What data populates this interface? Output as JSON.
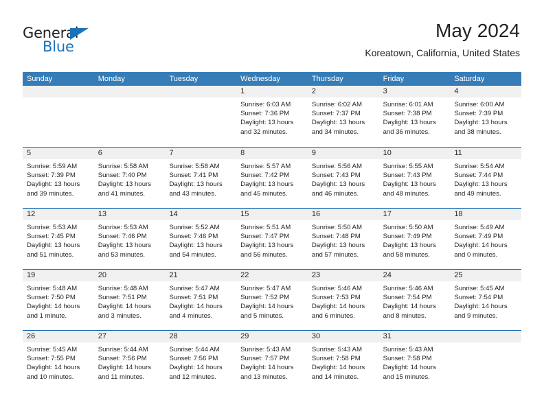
{
  "brand": {
    "name_part1": "General",
    "name_part2": "Blue",
    "accent_color": "#1b72b8"
  },
  "header": {
    "title": "May 2024",
    "location": "Koreatown, California, United States"
  },
  "calendar": {
    "header_bg": "#367cb7",
    "row_divider_color": "#1b6cb0",
    "day_band_bg": "#f0f0f0",
    "weekdays": [
      "Sunday",
      "Monday",
      "Tuesday",
      "Wednesday",
      "Thursday",
      "Friday",
      "Saturday"
    ],
    "weeks": [
      [
        {
          "day": "",
          "lines": []
        },
        {
          "day": "",
          "lines": []
        },
        {
          "day": "",
          "lines": []
        },
        {
          "day": "1",
          "lines": [
            "Sunrise: 6:03 AM",
            "Sunset: 7:36 PM",
            "Daylight: 13 hours",
            "and 32 minutes."
          ]
        },
        {
          "day": "2",
          "lines": [
            "Sunrise: 6:02 AM",
            "Sunset: 7:37 PM",
            "Daylight: 13 hours",
            "and 34 minutes."
          ]
        },
        {
          "day": "3",
          "lines": [
            "Sunrise: 6:01 AM",
            "Sunset: 7:38 PM",
            "Daylight: 13 hours",
            "and 36 minutes."
          ]
        },
        {
          "day": "4",
          "lines": [
            "Sunrise: 6:00 AM",
            "Sunset: 7:39 PM",
            "Daylight: 13 hours",
            "and 38 minutes."
          ]
        }
      ],
      [
        {
          "day": "5",
          "lines": [
            "Sunrise: 5:59 AM",
            "Sunset: 7:39 PM",
            "Daylight: 13 hours",
            "and 39 minutes."
          ]
        },
        {
          "day": "6",
          "lines": [
            "Sunrise: 5:58 AM",
            "Sunset: 7:40 PM",
            "Daylight: 13 hours",
            "and 41 minutes."
          ]
        },
        {
          "day": "7",
          "lines": [
            "Sunrise: 5:58 AM",
            "Sunset: 7:41 PM",
            "Daylight: 13 hours",
            "and 43 minutes."
          ]
        },
        {
          "day": "8",
          "lines": [
            "Sunrise: 5:57 AM",
            "Sunset: 7:42 PM",
            "Daylight: 13 hours",
            "and 45 minutes."
          ]
        },
        {
          "day": "9",
          "lines": [
            "Sunrise: 5:56 AM",
            "Sunset: 7:43 PM",
            "Daylight: 13 hours",
            "and 46 minutes."
          ]
        },
        {
          "day": "10",
          "lines": [
            "Sunrise: 5:55 AM",
            "Sunset: 7:43 PM",
            "Daylight: 13 hours",
            "and 48 minutes."
          ]
        },
        {
          "day": "11",
          "lines": [
            "Sunrise: 5:54 AM",
            "Sunset: 7:44 PM",
            "Daylight: 13 hours",
            "and 49 minutes."
          ]
        }
      ],
      [
        {
          "day": "12",
          "lines": [
            "Sunrise: 5:53 AM",
            "Sunset: 7:45 PM",
            "Daylight: 13 hours",
            "and 51 minutes."
          ]
        },
        {
          "day": "13",
          "lines": [
            "Sunrise: 5:53 AM",
            "Sunset: 7:46 PM",
            "Daylight: 13 hours",
            "and 53 minutes."
          ]
        },
        {
          "day": "14",
          "lines": [
            "Sunrise: 5:52 AM",
            "Sunset: 7:46 PM",
            "Daylight: 13 hours",
            "and 54 minutes."
          ]
        },
        {
          "day": "15",
          "lines": [
            "Sunrise: 5:51 AM",
            "Sunset: 7:47 PM",
            "Daylight: 13 hours",
            "and 56 minutes."
          ]
        },
        {
          "day": "16",
          "lines": [
            "Sunrise: 5:50 AM",
            "Sunset: 7:48 PM",
            "Daylight: 13 hours",
            "and 57 minutes."
          ]
        },
        {
          "day": "17",
          "lines": [
            "Sunrise: 5:50 AM",
            "Sunset: 7:49 PM",
            "Daylight: 13 hours",
            "and 58 minutes."
          ]
        },
        {
          "day": "18",
          "lines": [
            "Sunrise: 5:49 AM",
            "Sunset: 7:49 PM",
            "Daylight: 14 hours",
            "and 0 minutes."
          ]
        }
      ],
      [
        {
          "day": "19",
          "lines": [
            "Sunrise: 5:48 AM",
            "Sunset: 7:50 PM",
            "Daylight: 14 hours",
            "and 1 minute."
          ]
        },
        {
          "day": "20",
          "lines": [
            "Sunrise: 5:48 AM",
            "Sunset: 7:51 PM",
            "Daylight: 14 hours",
            "and 3 minutes."
          ]
        },
        {
          "day": "21",
          "lines": [
            "Sunrise: 5:47 AM",
            "Sunset: 7:51 PM",
            "Daylight: 14 hours",
            "and 4 minutes."
          ]
        },
        {
          "day": "22",
          "lines": [
            "Sunrise: 5:47 AM",
            "Sunset: 7:52 PM",
            "Daylight: 14 hours",
            "and 5 minutes."
          ]
        },
        {
          "day": "23",
          "lines": [
            "Sunrise: 5:46 AM",
            "Sunset: 7:53 PM",
            "Daylight: 14 hours",
            "and 6 minutes."
          ]
        },
        {
          "day": "24",
          "lines": [
            "Sunrise: 5:46 AM",
            "Sunset: 7:54 PM",
            "Daylight: 14 hours",
            "and 8 minutes."
          ]
        },
        {
          "day": "25",
          "lines": [
            "Sunrise: 5:45 AM",
            "Sunset: 7:54 PM",
            "Daylight: 14 hours",
            "and 9 minutes."
          ]
        }
      ],
      [
        {
          "day": "26",
          "lines": [
            "Sunrise: 5:45 AM",
            "Sunset: 7:55 PM",
            "Daylight: 14 hours",
            "and 10 minutes."
          ]
        },
        {
          "day": "27",
          "lines": [
            "Sunrise: 5:44 AM",
            "Sunset: 7:56 PM",
            "Daylight: 14 hours",
            "and 11 minutes."
          ]
        },
        {
          "day": "28",
          "lines": [
            "Sunrise: 5:44 AM",
            "Sunset: 7:56 PM",
            "Daylight: 14 hours",
            "and 12 minutes."
          ]
        },
        {
          "day": "29",
          "lines": [
            "Sunrise: 5:43 AM",
            "Sunset: 7:57 PM",
            "Daylight: 14 hours",
            "and 13 minutes."
          ]
        },
        {
          "day": "30",
          "lines": [
            "Sunrise: 5:43 AM",
            "Sunset: 7:58 PM",
            "Daylight: 14 hours",
            "and 14 minutes."
          ]
        },
        {
          "day": "31",
          "lines": [
            "Sunrise: 5:43 AM",
            "Sunset: 7:58 PM",
            "Daylight: 14 hours",
            "and 15 minutes."
          ]
        },
        {
          "day": "",
          "lines": []
        }
      ]
    ]
  }
}
